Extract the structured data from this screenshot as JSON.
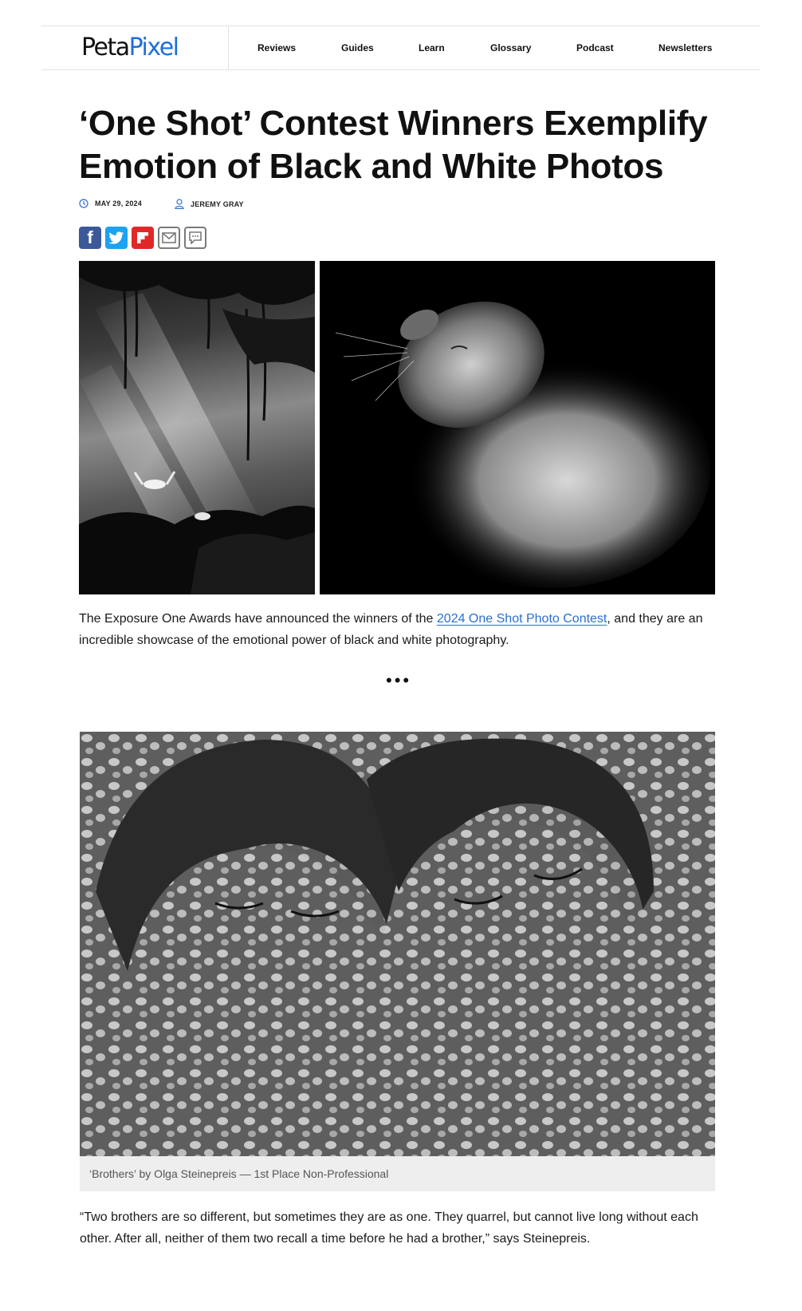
{
  "header": {
    "logo_part1": "Peta",
    "logo_part2": "Pixel",
    "nav": [
      "Reviews",
      "Guides",
      "Learn",
      "Glossary",
      "Podcast",
      "Newsletters"
    ]
  },
  "article": {
    "title": "‘One Shot’ Contest Winners Exemplify Emotion of Black and White Photos",
    "date": "MAY 29, 2024",
    "author": "JEREMY GRAY",
    "intro_before": "The Exposure One Awards have announced the winners of the ",
    "intro_link": "2024 One Shot Photo Contest",
    "intro_after": ", and they are an incredible showcase of the emotional power of black and white photography.",
    "separator": "•••",
    "caption": "‘Brothers’ by Olga Steinepreis — 1st Place Non-Professional",
    "quote": "“Two brothers are so different, but sometimes they are as one. They quarrel, but cannot live long without each other. After all, neither of them two recall a time before he had a brother,” says Steinepreis."
  },
  "share": {
    "icons": [
      "facebook-icon",
      "twitter-icon",
      "flipboard-icon",
      "email-icon",
      "comment-icon"
    ]
  },
  "colors": {
    "accent": "#1e6fd9",
    "link": "#2a6fd0",
    "facebook": "#3b5998",
    "twitter": "#1da1f2",
    "flipboard": "#e12828"
  }
}
